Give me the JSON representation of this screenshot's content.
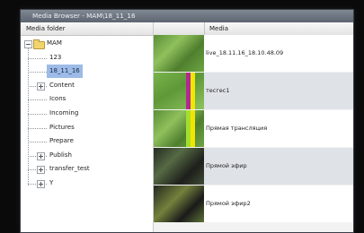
{
  "window": {
    "title": "Media Browser - MAM\\18_11_16"
  },
  "tree": {
    "header": "Media folder",
    "items": [
      {
        "label": "MAM",
        "level": 0,
        "expander": "minus",
        "folder": true,
        "selected": false
      },
      {
        "label": "123",
        "level": 1,
        "expander": "",
        "folder": false,
        "selected": false
      },
      {
        "label": "18_11_16",
        "level": 1,
        "expander": "",
        "folder": false,
        "selected": true
      },
      {
        "label": "Content",
        "level": 1,
        "expander": "plus",
        "folder": false,
        "selected": false
      },
      {
        "label": "Icons",
        "level": 1,
        "expander": "",
        "folder": false,
        "selected": false
      },
      {
        "label": "Incoming",
        "level": 1,
        "expander": "",
        "folder": false,
        "selected": false
      },
      {
        "label": "Pictures",
        "level": 1,
        "expander": "",
        "folder": false,
        "selected": false
      },
      {
        "label": "Prepare",
        "level": 1,
        "expander": "",
        "folder": false,
        "selected": false
      },
      {
        "label": "Publish",
        "level": 1,
        "expander": "plus",
        "folder": false,
        "selected": false
      },
      {
        "label": "transfer_test",
        "level": 1,
        "expander": "plus",
        "folder": false,
        "selected": false
      },
      {
        "label": "Y",
        "level": 1,
        "expander": "plus",
        "folder": false,
        "selected": false
      }
    ]
  },
  "table": {
    "header": "Media",
    "rows": [
      {
        "title": "live_18.11.16_18.10.48.09",
        "thumb": "grass",
        "bars": []
      },
      {
        "title": "тесгес1",
        "thumb": "grass2",
        "bars": [
          "#b02b8e",
          "#f1e600"
        ]
      },
      {
        "title": "Прямая трансляция",
        "thumb": "grass",
        "bars": [
          "#a5dd2c",
          "#f1e600"
        ]
      },
      {
        "title": "Прямой эфир",
        "thumb": "night",
        "bars": []
      },
      {
        "title": "Прямой эфир2",
        "thumb": "player",
        "bars": []
      }
    ]
  },
  "colors": {
    "selection": "#9dbbe8",
    "row_odd": "#ffffff",
    "row_even": "#dfe3e8"
  }
}
